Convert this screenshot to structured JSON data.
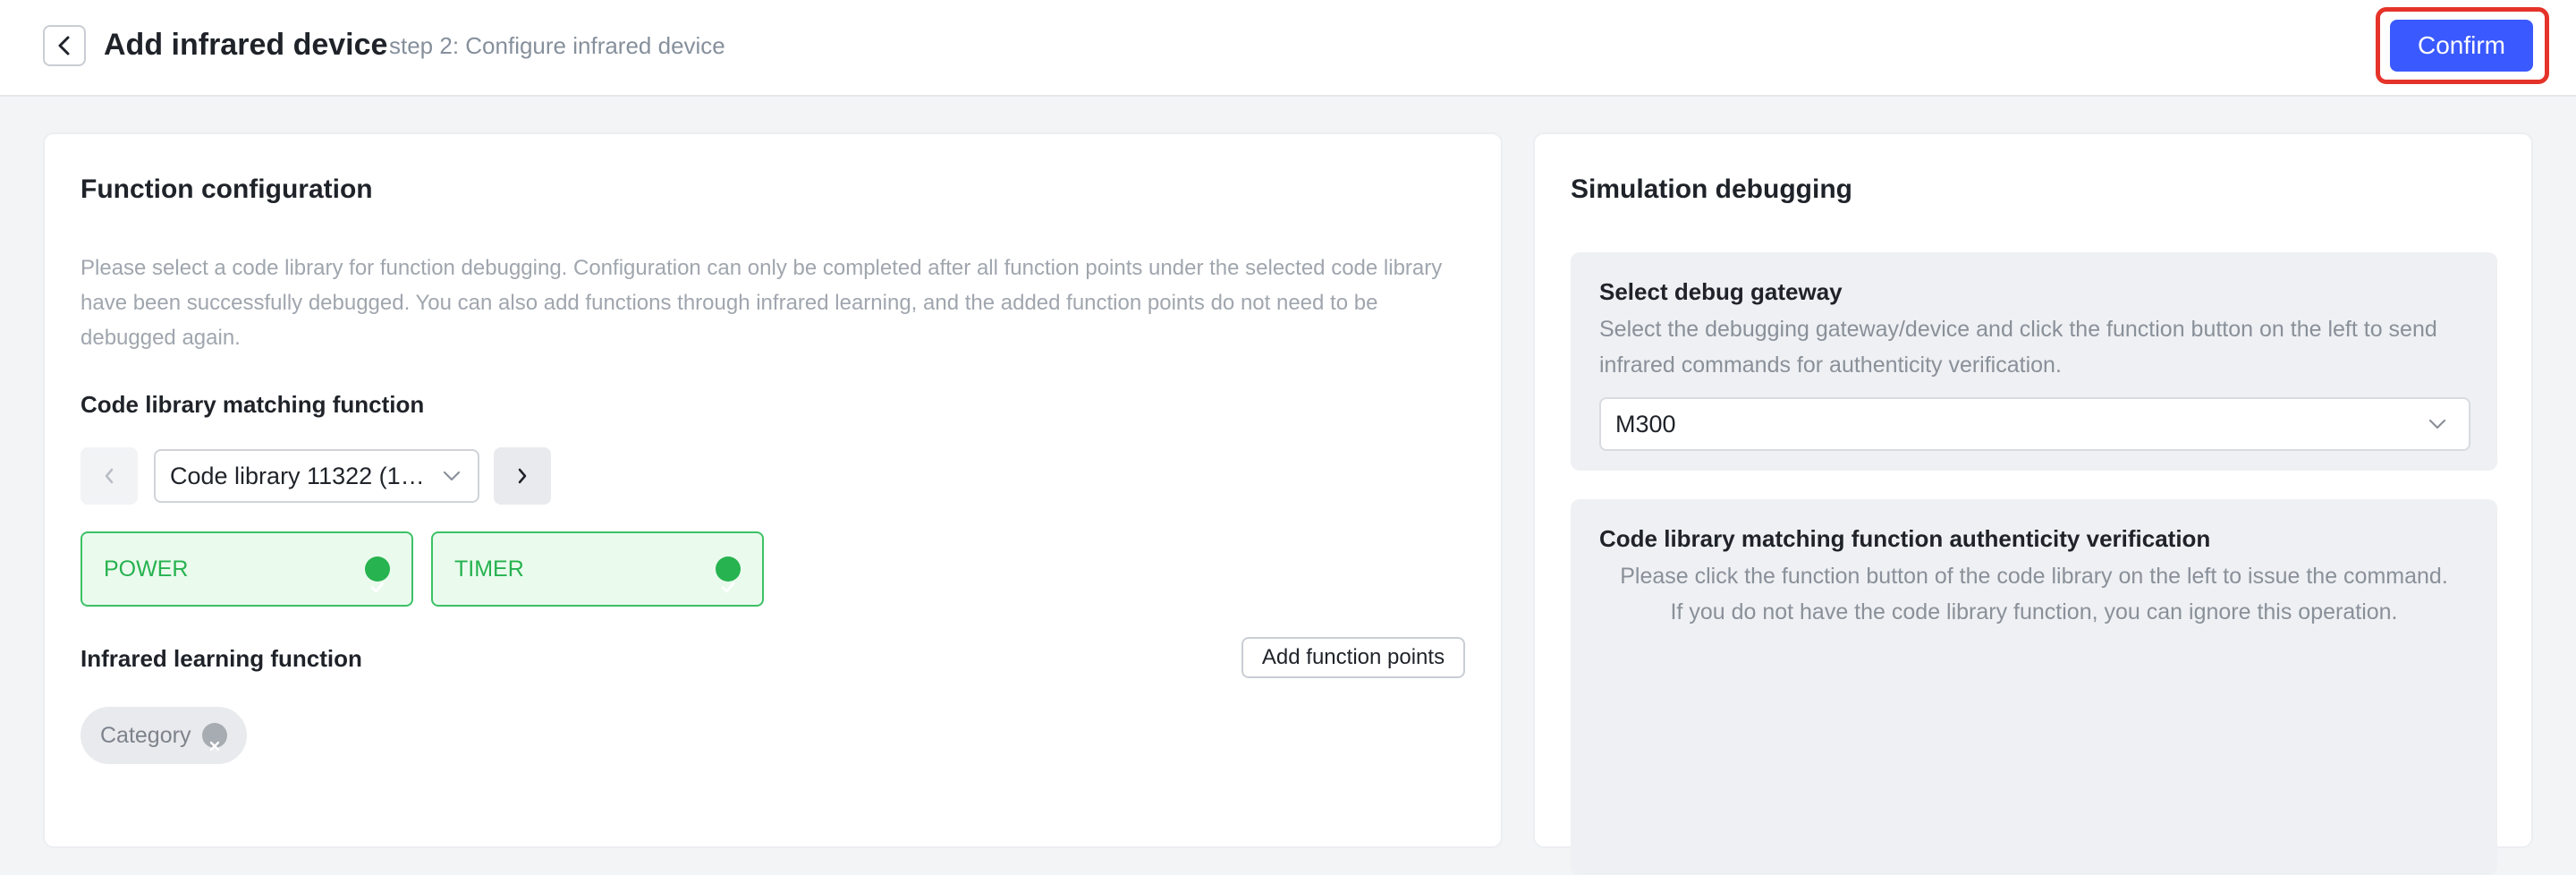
{
  "header": {
    "title": "Add infrared device",
    "subtitle": "step 2: Configure infrared device",
    "back_icon": "chevron-left-icon",
    "confirm_label": "Confirm"
  },
  "function_config": {
    "title": "Function configuration",
    "description": "Please select a code library for function debugging. Configuration can only be completed after all function points under the selected code library have been successfully debugged. You can also add functions through infrared learning, and the added function points do not need to be debugged again.",
    "code_library_section": "Code library matching function",
    "code_library_selected": "Code library 11322 (1…",
    "functions": [
      {
        "label": "POWER",
        "status": "verified"
      },
      {
        "label": "TIMER",
        "status": "verified"
      }
    ],
    "ir_learning_section": "Infrared learning function",
    "add_function_points_label": "Add function points",
    "tags": [
      {
        "label": "Category"
      }
    ]
  },
  "simulation": {
    "title": "Simulation debugging",
    "gateway_title": "Select debug gateway",
    "gateway_desc": "Select the debugging gateway/device and click the function button on the left to send infrared commands for authenticity verification.",
    "gateway_selected": "M300",
    "verify_title": "Code library matching function authenticity verification",
    "verify_line1": "Please click the function button of the code library on the left to issue the command.",
    "verify_line2": "If you do not have the code library function, you can ignore this operation."
  },
  "colors": {
    "accent": "#3a59ff",
    "highlight_border": "#e5332a",
    "success": "#27b34f",
    "success_bg": "#eafbee"
  }
}
